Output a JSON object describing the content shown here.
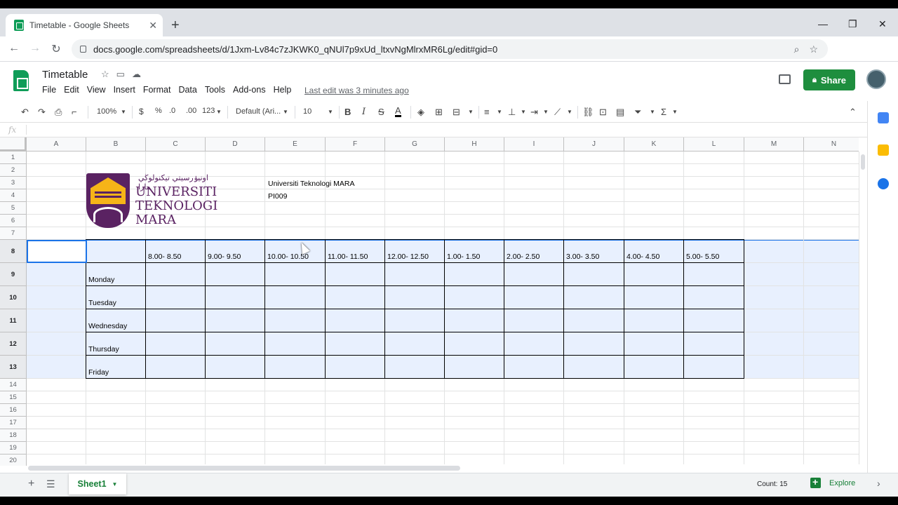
{
  "browser": {
    "tab_title": "Timetable - Google Sheets",
    "tab_close": "✕",
    "new_tab": "+",
    "url": "docs.google.com/spreadsheets/d/1Jxm-Lv84c7zJKWK0_qNUl7p9xUd_ltxvNgMlrxMR6Lg/edit#gid=0",
    "window_controls": [
      "—",
      "❐",
      "✕"
    ]
  },
  "doc": {
    "title": "Timetable",
    "menu": [
      "File",
      "Edit",
      "View",
      "Insert",
      "Format",
      "Data",
      "Tools",
      "Add-ons",
      "Help"
    ],
    "last_edit": "Last edit was 3 minutes ago",
    "share_label": "Share"
  },
  "toolbar": {
    "zoom": "100%",
    "currency": "$",
    "percent": "%",
    "dec_decrease": ".0",
    "dec_increase": ".00",
    "more_formats": "123",
    "font": "Default (Ari...",
    "font_size": "10",
    "bold": "B",
    "italic": "I",
    "strike": "S",
    "text_color": "A"
  },
  "formula_bar": {
    "fx": "fx",
    "value": ""
  },
  "grid": {
    "columns": [
      "A",
      "B",
      "C",
      "D",
      "E",
      "F",
      "G",
      "H",
      "I",
      "J",
      "K",
      "L",
      "M",
      "N"
    ],
    "rows": [
      "1",
      "2",
      "3",
      "4",
      "5",
      "6",
      "7",
      "8",
      "9",
      "10",
      "11",
      "12",
      "13",
      "14",
      "15",
      "16",
      "17",
      "18",
      "19",
      "20"
    ],
    "selected_rows": [
      "8",
      "9",
      "10",
      "11",
      "12",
      "13"
    ],
    "cells": {
      "E3": "Universiti Teknologi MARA",
      "E4": "PI009"
    },
    "time_slots": [
      "8.00- 8.50",
      "9.00- 9.50",
      "10.00- 10.50",
      "11.00- 11.50",
      "12.00- 12.50",
      "1.00- 1.50",
      "2.00- 2.50",
      "3.00- 3.50",
      "4.00- 4.50",
      "5.00- 5.50"
    ],
    "days": [
      "Monday",
      "Tuesday",
      "Wednesday",
      "Thursday",
      "Friday"
    ]
  },
  "logo": {
    "jawi": "اونيۏرسيتي تيكنولوڬي مارا",
    "lines": [
      "UNIVERSITI",
      "TEKNOLOGI",
      "MARA"
    ],
    "colors": {
      "purple": "#5a2262",
      "gold": "#f6b418"
    }
  },
  "footer": {
    "add_sheet": "+",
    "sheet_name": "Sheet1",
    "count": "Count: 15",
    "explore": "Explore"
  },
  "colors": {
    "sheets_green": "#0f9d58",
    "share_green": "#1e8e3e",
    "selection_blue": "#1a73e8",
    "selection_fill": "#e8f0fe"
  }
}
